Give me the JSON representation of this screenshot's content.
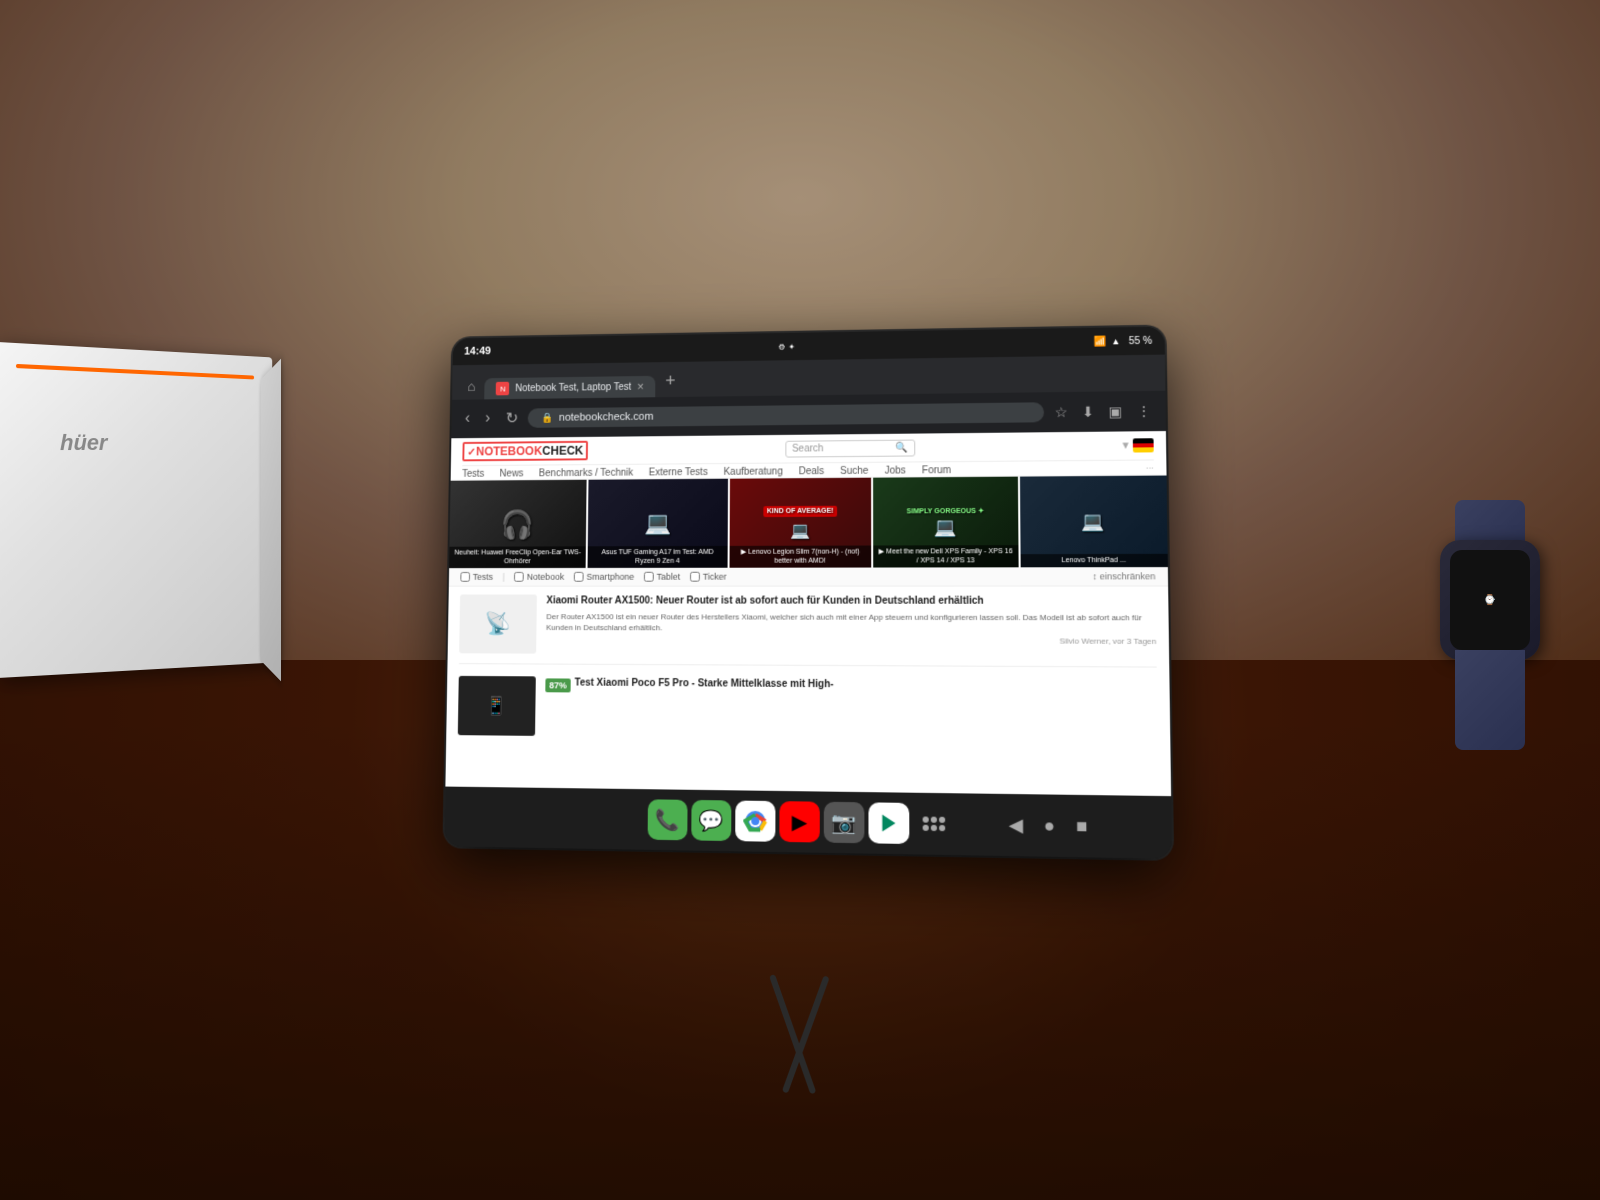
{
  "scene": {
    "desk_color": "#3a1505",
    "wall_color": "#d4c4a8"
  },
  "android": {
    "status_time": "14:49",
    "battery": "55 %",
    "tab_title": "Notebook Test, Laptop Test",
    "url": "notebookcheck.com",
    "new_tab_label": "+"
  },
  "browser": {
    "toolbar": {
      "back": "‹",
      "forward": "›",
      "reload": "↻",
      "star": "☆",
      "download": "⬇",
      "reader": "☰",
      "menu": "⋮"
    }
  },
  "website": {
    "logo_check": "✓",
    "logo_notebook": "NOTEBOOK",
    "logo_check_word": "CHECK",
    "search_placeholder": "Search",
    "nav_items": [
      "Tests",
      "News",
      "Benchmarks / Technik",
      "Externe Tests",
      "Kaufberatung",
      "Deals",
      "Suche",
      "Jobs",
      "Forum"
    ],
    "hero_items": [
      {
        "title": "Neuheit: Huawei FreeClip Open-Ear TWS-Ohrhörer",
        "bg": "#222"
      },
      {
        "title": "Asus TUF Gaming A17 im Test: AMD Ryzen 9 Zen 4",
        "bg": "#1a1a2a"
      },
      {
        "title": "▶ Lenovo Legion Slim 7(non-H) - (not) better with AMD!",
        "bg": "#8a1a1a"
      },
      {
        "title": "▶ Meet the new Dell XPS Family - XPS 16 / XPS 14 / XPS 13",
        "bg": "#1a3a1a"
      },
      {
        "title": "Lenovo ThinkPad ...",
        "bg": "#1a2a3a"
      }
    ],
    "filters": {
      "tests_label": "Tests",
      "notebook_label": "Notebook",
      "smartphone_label": "Smartphone",
      "tablet_label": "Tablet",
      "ticker_label": "Ticker",
      "restrict_label": "↕ einschränken"
    },
    "news": [
      {
        "title": "Xiaomi Router AX1500: Neuer Router ist ab sofort auch für Kunden in Deutschland erhältlich",
        "excerpt": "Der Router AX1500 ist ein neuer Router des Herstellers Xiaomi, welcher sich auch mit einer App steuern und konfigurieren lassen soll. Das Modell ist ab sofort auch für Kunden in Deutschland erhältlich.",
        "meta": "Silvio Werner, vor 3 Tagen",
        "thumb_bg": "#f0f0f0"
      },
      {
        "score": "87%",
        "title": "Test Xiaomi Poco F5 Pro - Starke Mittelklasse mit High-",
        "thumb_bg": "#222"
      }
    ]
  },
  "dock": {
    "apps": [
      {
        "icon": "📞",
        "name": "phone",
        "bg": "#4CAF50"
      },
      {
        "icon": "💬",
        "name": "messages",
        "bg": "#4CAF50"
      },
      {
        "icon": "🌐",
        "name": "chrome",
        "bg": "#fff"
      },
      {
        "icon": "▶",
        "name": "youtube",
        "bg": "#FF0000"
      },
      {
        "icon": "📷",
        "name": "camera",
        "bg": "#555"
      },
      {
        "icon": "▷",
        "name": "play-store",
        "bg": "#fff"
      },
      {
        "icon": "⠿",
        "name": "app-drawer",
        "bg": "transparent"
      }
    ],
    "nav": {
      "back": "◀",
      "home": "●",
      "recents": "■"
    }
  }
}
